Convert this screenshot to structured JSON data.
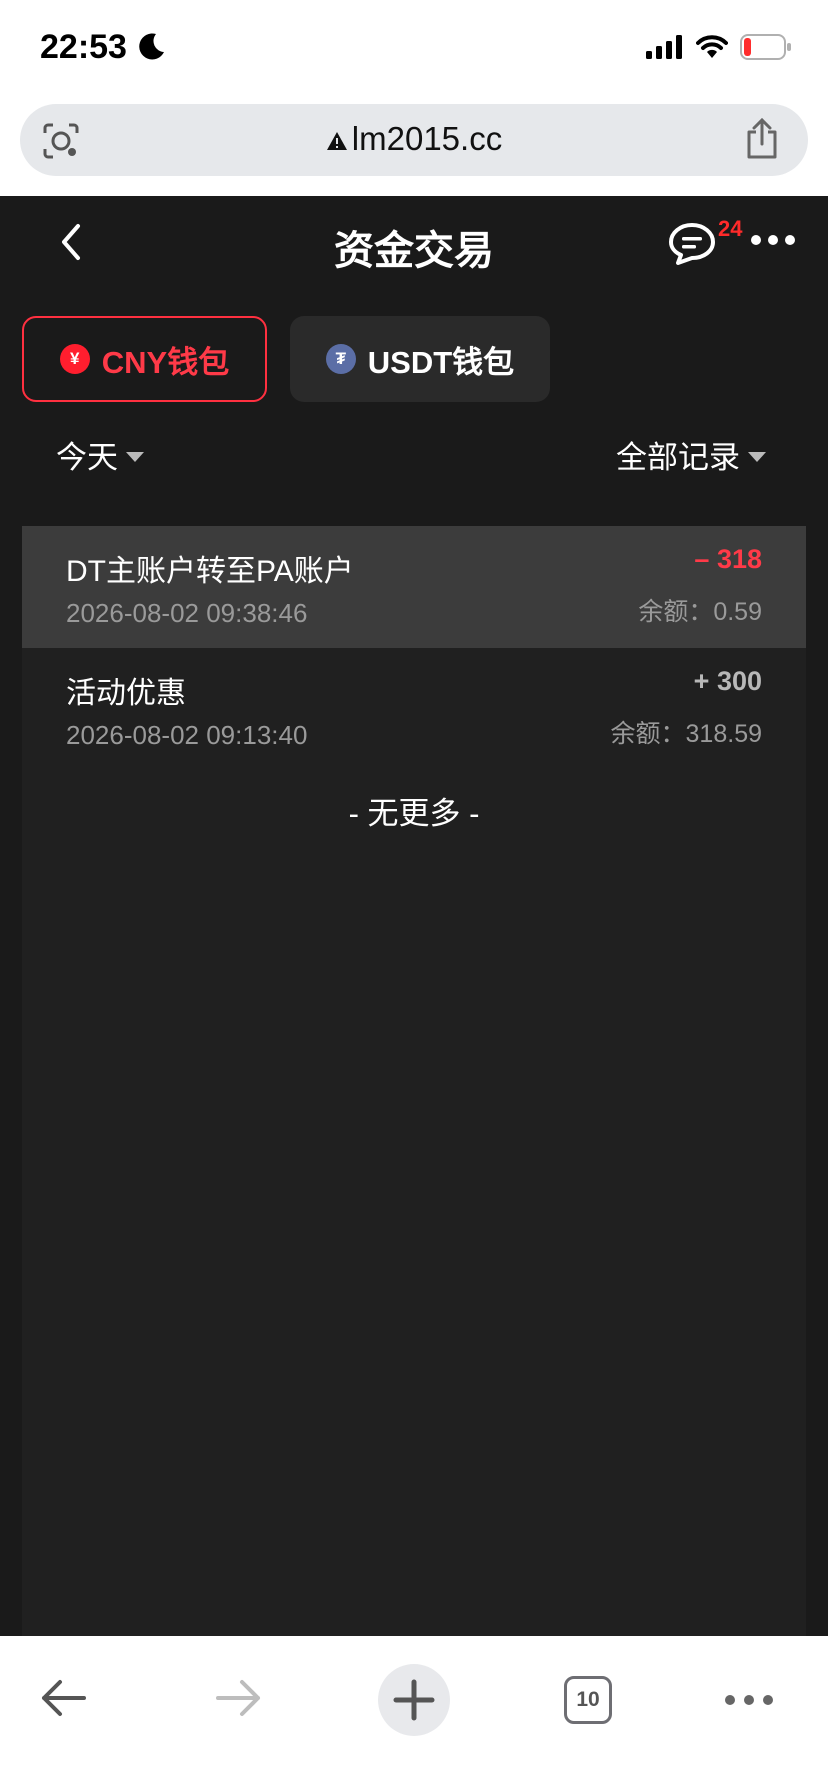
{
  "status_bar": {
    "time": "22:53"
  },
  "browser": {
    "url": "lm2015.cc",
    "tab_count": "10"
  },
  "header": {
    "title": "资金交易",
    "message_badge": "24"
  },
  "wallet_tabs": [
    {
      "label": "CNY钱包",
      "coin_symbol": "¥",
      "active": true
    },
    {
      "label": "USDT钱包",
      "coin_symbol": "₮",
      "active": false
    }
  ],
  "filters": {
    "date": "今天",
    "record_type": "全部记录"
  },
  "transactions": [
    {
      "title": "DT主账户转至PA账户",
      "time": "2026-08-02 09:38:46",
      "amount": "– 318",
      "balance": "余额：0.59"
    },
    {
      "title": "活动优惠",
      "time": "2026-08-02 09:13:40",
      "amount": "+ 300",
      "balance": "余额：318.59"
    }
  ],
  "footer_text": "- 无更多 -",
  "colors": {
    "accent_red": "#ff3a48",
    "background": "#1a1a1a",
    "panel": "#202020",
    "row_highlight": "#3c3c3c"
  },
  "icons": [
    "moon-icon",
    "signal-icon",
    "wifi-icon",
    "battery-icon",
    "camera-search-icon",
    "warning-icon",
    "share-icon",
    "back-chevron-icon",
    "message-icon",
    "more-dots-icon",
    "arrow-left-icon",
    "arrow-right-icon",
    "plus-icon",
    "tabs-icon"
  ]
}
